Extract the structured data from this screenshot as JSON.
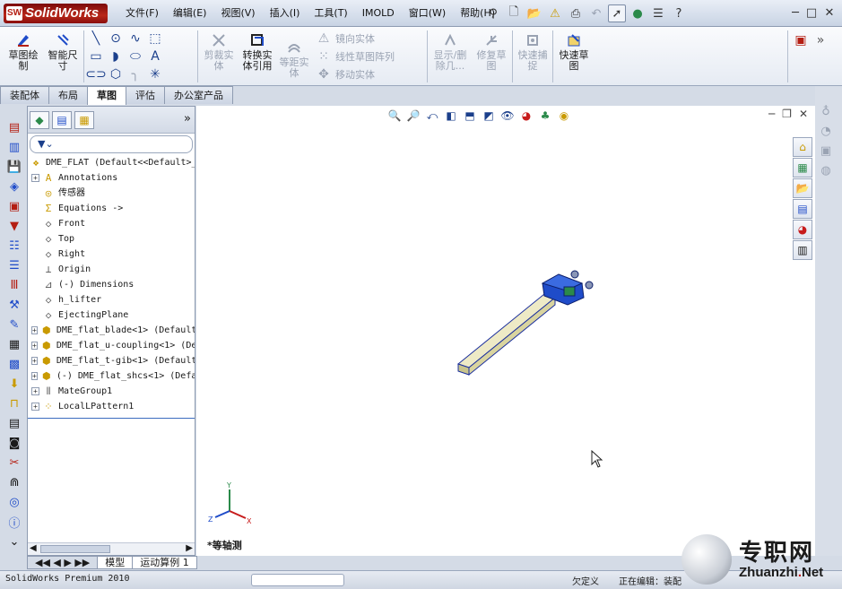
{
  "app": {
    "logo": "SolidWorks",
    "logo_badge": "SW"
  },
  "menus": [
    "文件(F)",
    "编辑(E)",
    "视图(V)",
    "插入(I)",
    "工具(T)",
    "IMOLD",
    "窗口(W)",
    "帮助(H)"
  ],
  "ribbon": {
    "sketch": "草图绘制",
    "smart_dim": "智能尺寸",
    "trim": "剪裁实体",
    "convert": "转换实体引用",
    "offset": "等距实体",
    "mirror": "镜向实体",
    "linear_pattern": "线性草图阵列",
    "move": "移动实体",
    "show_delete": "显示/删除几...",
    "repair": "修复草图",
    "quick_snap": "快速捕捉",
    "quick_sketch": "快速草图"
  },
  "command_tabs": [
    "装配体",
    "布局",
    "草图",
    "评估",
    "办公室产品"
  ],
  "active_tab": "草图",
  "feature_tree": {
    "root": "DME_FLAT  (Default<<Default>_",
    "items": [
      {
        "label": "Annotations",
        "expandable": true,
        "icon": "annotations-icon"
      },
      {
        "label": "传感器",
        "expandable": false,
        "icon": "sensor-icon"
      },
      {
        "label": "Equations ->",
        "expandable": false,
        "icon": "equations-icon"
      },
      {
        "label": "Front",
        "expandable": false,
        "icon": "plane-icon"
      },
      {
        "label": "Top",
        "expandable": false,
        "icon": "plane-icon"
      },
      {
        "label": "Right",
        "expandable": false,
        "icon": "plane-icon"
      },
      {
        "label": "Origin",
        "expandable": false,
        "icon": "origin-icon"
      },
      {
        "label": "(-) Dimensions",
        "expandable": false,
        "icon": "sketch-icon"
      },
      {
        "label": "h_lifter",
        "expandable": false,
        "icon": "plane-icon"
      },
      {
        "label": "EjectingPlane",
        "expandable": false,
        "icon": "plane-icon"
      },
      {
        "label": "DME_flat_blade<1> (Default",
        "expandable": true,
        "icon": "part-icon"
      },
      {
        "label": "DME_flat_u-coupling<1> (De",
        "expandable": true,
        "icon": "part-icon"
      },
      {
        "label": "DME_flat_t-gib<1> (Default",
        "expandable": true,
        "icon": "part-icon"
      },
      {
        "label": "(-) DME_flat_shcs<1> (Defa",
        "expandable": true,
        "icon": "part-icon"
      },
      {
        "label": "MateGroup1",
        "expandable": true,
        "icon": "mates-icon"
      },
      {
        "label": "LocalLPattern1",
        "expandable": true,
        "icon": "pattern-icon"
      }
    ]
  },
  "graphics": {
    "view_name": "*等轴测",
    "triad": {
      "x": "X",
      "y": "Y",
      "z": "Z"
    },
    "colors": {
      "part_body": "#e6e2b4",
      "part_edge": "#1b2f9e",
      "head": "#1f4cc9",
      "accent": "#2b8a4a"
    }
  },
  "bottom_tabs": [
    "模型",
    "运动算例 1"
  ],
  "status": {
    "product": "SolidWorks Premium 2010",
    "state": "欠定义",
    "editing": "正在编辑：装配"
  },
  "watermark": {
    "cn": "专职网",
    "en_main": "Zhuanzhi",
    "en_dot": ".",
    "en_tail": "Net"
  }
}
